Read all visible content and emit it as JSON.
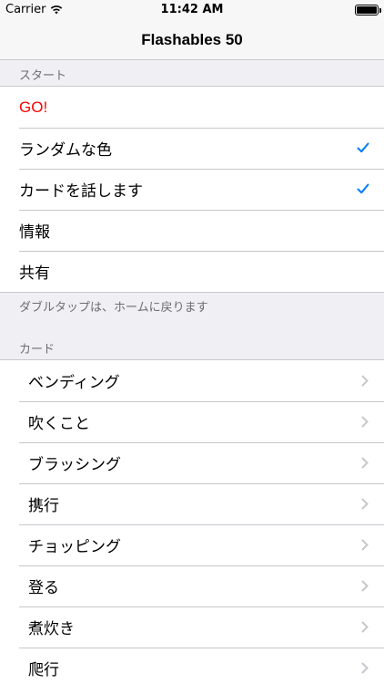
{
  "status": {
    "carrier": "Carrier",
    "time": "11:42 AM"
  },
  "nav": {
    "title": "Flashables 50"
  },
  "start_section": {
    "header": "スタート",
    "items": [
      {
        "label": "GO!",
        "checked": false
      },
      {
        "label": "ランダムな色",
        "checked": true
      },
      {
        "label": "カードを話します",
        "checked": true
      },
      {
        "label": "情報",
        "checked": false
      },
      {
        "label": "共有",
        "checked": false
      }
    ],
    "footer": "ダブルタップは、ホームに戻ります"
  },
  "cards_section": {
    "header": "カード",
    "items": [
      {
        "label": "ベンディング"
      },
      {
        "label": "吹くこと"
      },
      {
        "label": "ブラッシング"
      },
      {
        "label": "携行"
      },
      {
        "label": "チョッピング"
      },
      {
        "label": "登る"
      },
      {
        "label": "煮炊き"
      },
      {
        "label": "爬行"
      }
    ]
  },
  "colors": {
    "accent": "#007aff",
    "go_red": "#ff0000",
    "separator": "#c8c7cc",
    "group_bg": "#efeff4"
  }
}
